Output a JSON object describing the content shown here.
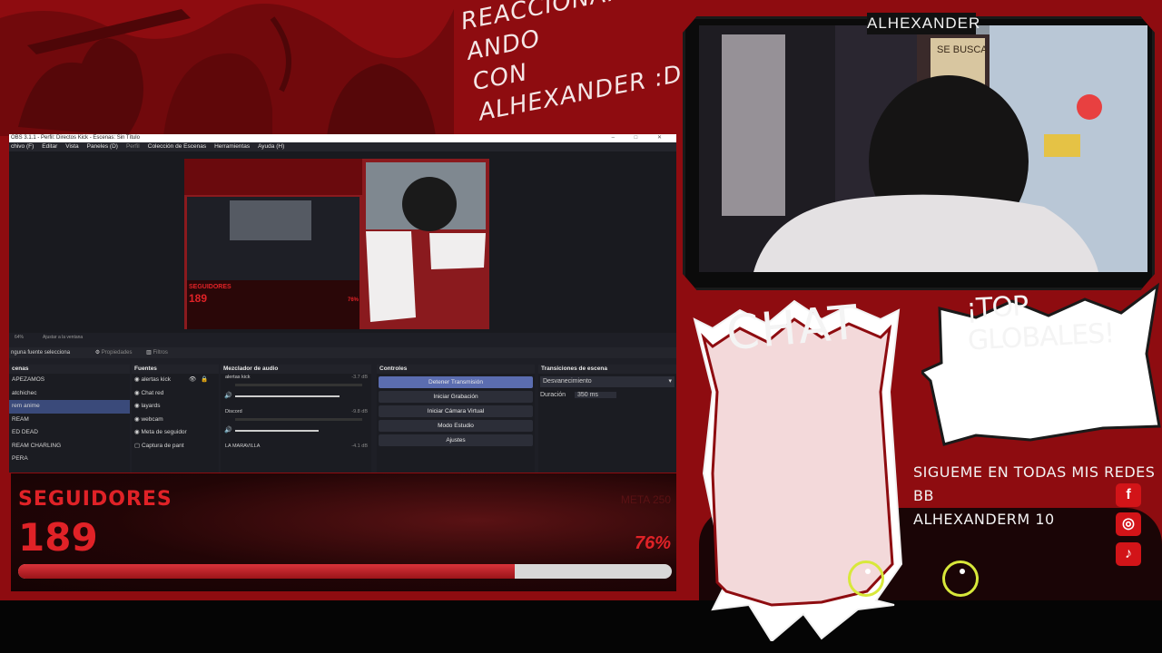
{
  "overlay": {
    "title_line1": "REACCIONANDO ANDO",
    "title_line2": "CON ALHEXANDER :D",
    "colors": {
      "primary": "#8e0c10",
      "accent": "#e02227",
      "panel": "#f2f2f2"
    }
  },
  "webcam": {
    "name": "ALHEXANDER",
    "sign_text": "SE BUSCA"
  },
  "obs": {
    "title": "OBS 3.1.1 - Perfil: Directos Kick - Escenas: Sin Título",
    "menu": [
      "chivo (F)",
      "Editar",
      "Vista",
      "Paneles (D)",
      "Perfil",
      "Colección de Escenas",
      "Herramientas",
      "Ayuda (H)"
    ],
    "zoom": "64%",
    "fit": "Ajustar a la ventana",
    "source_bar": {
      "none_selected": "nguna fuente selecciona",
      "properties": "Propiedades",
      "filters": "Filtros"
    },
    "preview": {
      "seguidores": "SEGUIDORES",
      "count": "189",
      "pct": "76%"
    },
    "docks": {
      "scenes": {
        "title": "cenas",
        "items": [
          "APEZAMOS",
          "atchichec",
          "rem anime",
          "REAM",
          "ED DEAD",
          "REAM CHARLING",
          "PERA"
        ],
        "selected": 2
      },
      "sources": {
        "title": "Fuentes",
        "items": [
          "alertas kick",
          "Chat red",
          "layards",
          "webcam",
          "Meta de seguidor",
          "Captura de pant"
        ]
      },
      "mixer": {
        "title": "Mezclador de audio",
        "channels": [
          {
            "name": "alertas kick",
            "db": "-3.7 dB",
            "level": 0.72
          },
          {
            "name": "Discord",
            "db": "-9.8 dB",
            "level": 0.62
          },
          {
            "name": "LA MARAVILLA",
            "db": "-4.1 dB",
            "level": 0.0
          }
        ]
      },
      "controls": {
        "title": "Controles",
        "buttons": [
          "Detener Transmisión",
          "Iniciar Grabación",
          "Iniciar Cámara Virtual",
          "Modo Estudio",
          "Ajustes"
        ]
      },
      "transitions": {
        "title": "Transiciones de escena",
        "selected": "Desvanecimiento",
        "duration_label": "Duración",
        "duration": "350 ms"
      }
    }
  },
  "followers": {
    "label": "SEGUIDORES",
    "count": "189",
    "goal": "META 250",
    "percent": "76%",
    "progress": 0.76
  },
  "chat": {
    "title": "CHAT"
  },
  "globales": {
    "title": "¡TOP GLOBALES!"
  },
  "social": {
    "line1": "SIGUEME EN TODAS MIS REDES BB",
    "line2": "ALHEXANDERM 10",
    "icons": [
      "facebook-icon",
      "instagram-icon",
      "tiktok-icon"
    ]
  }
}
